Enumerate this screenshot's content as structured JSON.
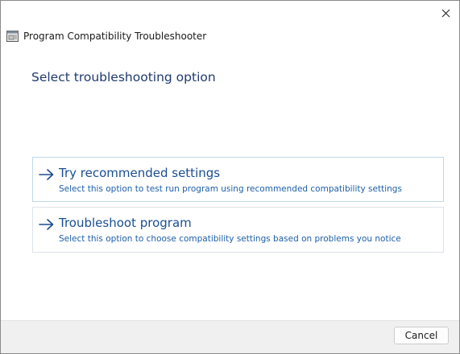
{
  "window": {
    "title": "Program Compatibility Troubleshooter",
    "close_icon": "close-icon",
    "app_icon": "compatibility-troubleshooter-icon"
  },
  "main": {
    "heading": "Select troubleshooting option",
    "options": [
      {
        "title": "Try recommended settings",
        "description": "Select this option to test run program using recommended compatibility settings",
        "icon": "arrow-right-icon"
      },
      {
        "title": "Troubleshoot program",
        "description": "Select this option to choose compatibility settings based on problems you notice",
        "icon": "arrow-right-icon"
      }
    ]
  },
  "footer": {
    "cancel_label": "Cancel"
  },
  "colors": {
    "heading": "#1f3a6e",
    "option_title": "#1a4e91",
    "option_desc": "#1e5fa8",
    "footer_bg": "#f0f0f0"
  }
}
